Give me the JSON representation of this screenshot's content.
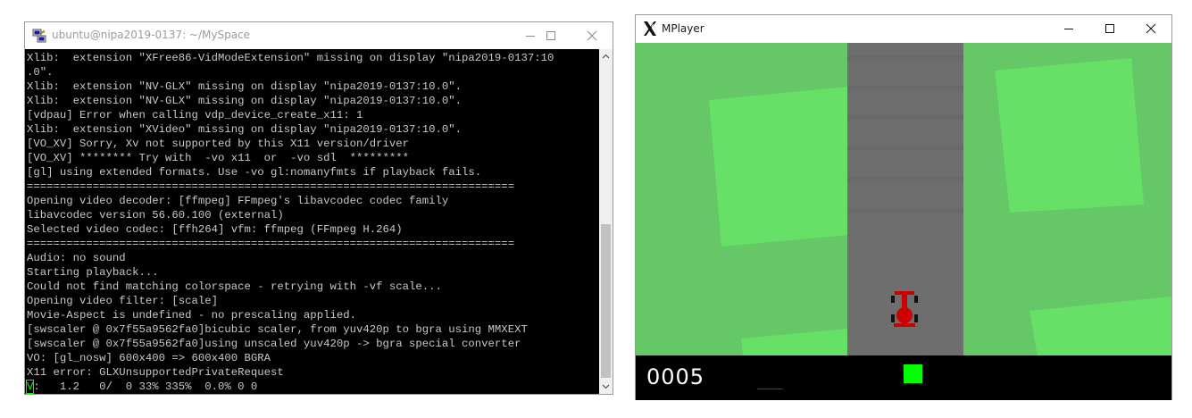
{
  "terminal": {
    "title": "ubuntu@nipa2019-0137: ~/MySpace",
    "lines": [
      "Xlib:  extension \"XFree86-VidModeExtension\" missing on display \"nipa2019-0137:10",
      ".0\".",
      "Xlib:  extension \"NV-GLX\" missing on display \"nipa2019-0137:10.0\".",
      "Xlib:  extension \"NV-GLX\" missing on display \"nipa2019-0137:10.0\".",
      "[vdpau] Error when calling vdp_device_create_x11: 1",
      "Xlib:  extension \"XVideo\" missing on display \"nipa2019-0137:10.0\".",
      "[VO_XV] Sorry, Xv not supported by this X11 version/driver",
      "[VO_XV] ******** Try with  -vo x11  or  -vo sdl  *********",
      "[gl] using extended formats. Use -vo gl:nomanyfmts if playback fails.",
      "==========================================================================",
      "Opening video decoder: [ffmpeg] FFmpeg's libavcodec codec family",
      "libavcodec version 56.60.100 (external)",
      "Selected video codec: [ffh264] vfm: ffmpeg (FFmpeg H.264)",
      "==========================================================================",
      "Audio: no sound",
      "Starting playback...",
      "Could not find matching colorspace - retrying with -vf scale...",
      "Opening video filter: [scale]",
      "Movie-Aspect is undefined - no prescaling applied.",
      "[swscaler @ 0x7f55a9562fa0]bicubic scaler, from yuv420p to bgra using MMXEXT",
      "[swscaler @ 0x7f55a9562fa0]using unscaled yuv420p -> bgra special converter",
      "VO: [gl_nosw] 600x400 => 600x400 BGRA",
      "X11 error: GLXUnsupportedPrivateRequest"
    ],
    "status_prefix": "V",
    "status_rest": ":   1.2   0/  0 33% 335%  0.0% 0 0"
  },
  "mplayer": {
    "title": "MPlayer",
    "score": "0005"
  },
  "icons": {
    "terminal_app": "putty-icon",
    "minimize": "minimize-icon",
    "maximize": "maximize-icon",
    "close": "close-icon",
    "x_logo": "x-logo-icon",
    "scroll_up": "chevron-up-icon",
    "scroll_down": "chevron-down-icon"
  },
  "colors": {
    "grass": "#66c766",
    "grass_patch": "#66e066",
    "road": "#6e6e6e",
    "car": "#cc0000",
    "indicator": "#00ff00"
  }
}
